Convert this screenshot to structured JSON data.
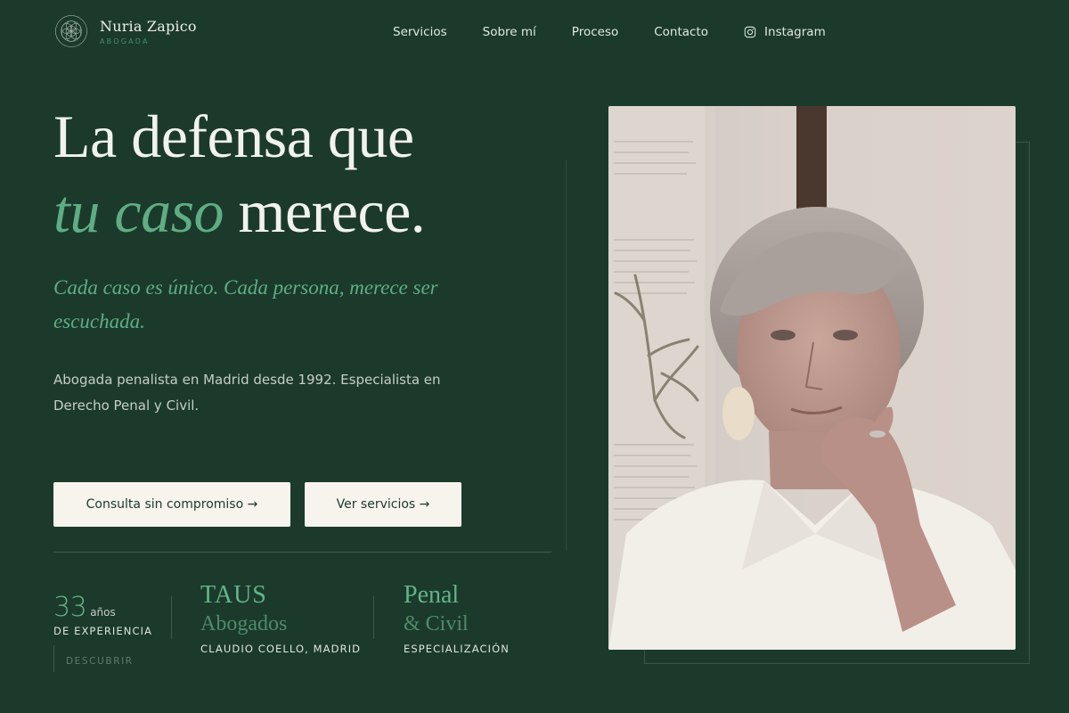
{
  "brand": {
    "name": "Nuria Zapico",
    "subtitle": "ABOGADA"
  },
  "nav": [
    {
      "label": "Servicios"
    },
    {
      "label": "Sobre mí"
    },
    {
      "label": "Proceso"
    },
    {
      "label": "Contacto"
    },
    {
      "label": "Instagram",
      "icon": "instagram-icon"
    }
  ],
  "hero": {
    "title_line1": "La defensa que",
    "title_accent": "tu caso",
    "title_rest": " merece.",
    "tagline": "Cada caso es único. Cada persona, merece ser escuchada.",
    "description": "Abogada penalista en Madrid desde 1992. Especialista en Derecho Penal y Civil."
  },
  "buttons": {
    "consult": "Consulta sin compromiso →",
    "services": "Ver servicios →"
  },
  "stats": {
    "years": {
      "number": "33",
      "unit": "años",
      "label": "DE EXPERIENCIA"
    },
    "firm": {
      "line1": "TAUS",
      "line2": "Abogados",
      "label": "CLAUDIO COELLO, MADRID"
    },
    "specialty": {
      "line1": "Penal",
      "line2": "& Civil",
      "label": "ESPECIALIZACIÓN"
    }
  },
  "discover": "DESCUBRIR",
  "colors": {
    "background": "#1b3a2c",
    "accent": "#5fae83",
    "button_bg": "#f7f3ed",
    "text": "#e9ece6"
  }
}
